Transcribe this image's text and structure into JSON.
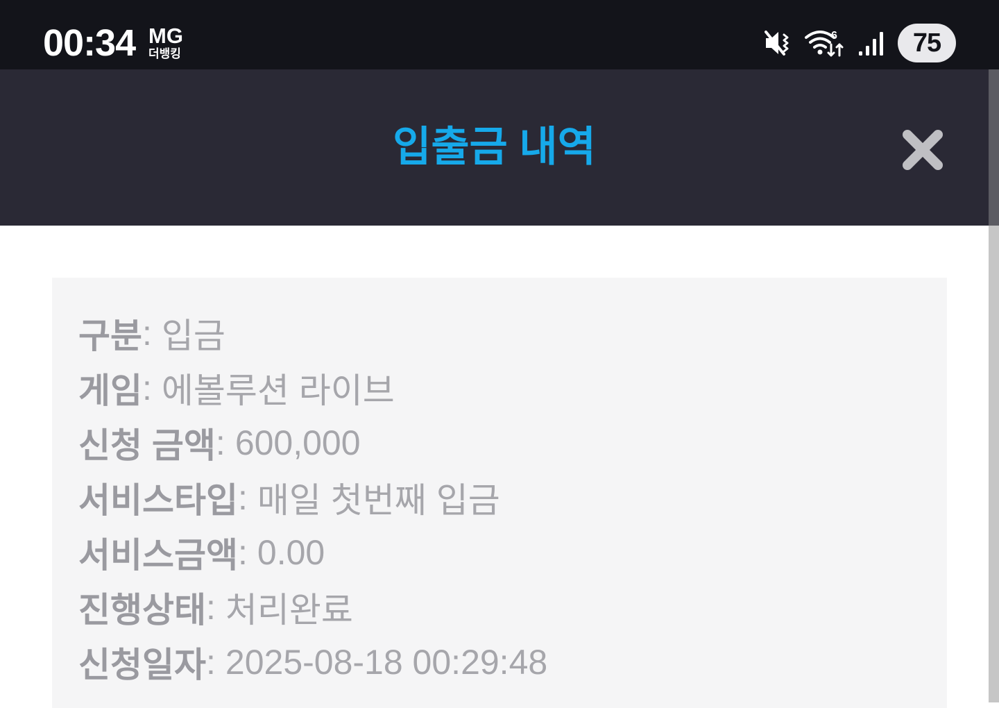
{
  "status_bar": {
    "time": "00:34",
    "notification_top": "MG",
    "notification_bottom": "더뱅킹",
    "battery": "75",
    "icons": [
      "vibrate-mute-icon",
      "wifi-icon",
      "signal-icon"
    ]
  },
  "header": {
    "title": "입출금 내역",
    "close_icon": "close-icon",
    "title_color": "#16a9ea",
    "background": "#2a2935"
  },
  "details": [
    {
      "label": "구분",
      "value": "입금"
    },
    {
      "label": "게임",
      "value": "에볼루션 라이브"
    },
    {
      "label": "신청 금액",
      "value": "600,000"
    },
    {
      "label": "서비스타입",
      "value": "매일 첫번째 입금"
    },
    {
      "label": "서비스금액",
      "value": "0.00"
    },
    {
      "label": "진행상태",
      "value": "처리완료"
    },
    {
      "label": "신청일자",
      "value": "2025-08-18 00:29:48"
    }
  ],
  "separator": ":"
}
